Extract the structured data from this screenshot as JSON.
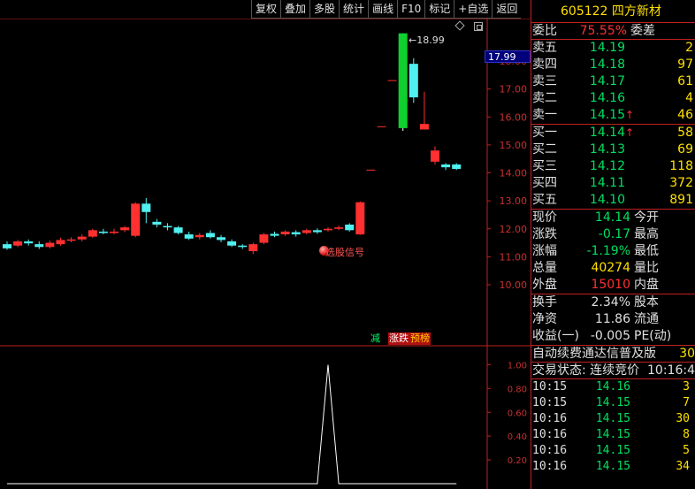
{
  "toolbar": [
    "复权",
    "叠加",
    "多股",
    "统计",
    "画线",
    "F10",
    "标记",
    "+自选",
    "返回"
  ],
  "stock": {
    "code": "605122",
    "name": "四方新材"
  },
  "weibi": {
    "label": "委比",
    "value": "75.55%",
    "label2": "委差"
  },
  "sell": [
    {
      "label": "卖五",
      "price": "14.19",
      "vol": "2",
      "arrow": ""
    },
    {
      "label": "卖四",
      "price": "14.18",
      "vol": "97",
      "arrow": ""
    },
    {
      "label": "卖三",
      "price": "14.17",
      "vol": "61",
      "arrow": ""
    },
    {
      "label": "卖二",
      "price": "14.16",
      "vol": "4",
      "arrow": ""
    },
    {
      "label": "卖一",
      "price": "14.15",
      "vol": "46",
      "arrow": "↑"
    }
  ],
  "buy": [
    {
      "label": "买一",
      "price": "14.14",
      "vol": "58",
      "arrow": "↑"
    },
    {
      "label": "买二",
      "price": "14.13",
      "vol": "69",
      "arrow": ""
    },
    {
      "label": "买三",
      "price": "14.12",
      "vol": "118",
      "arrow": ""
    },
    {
      "label": "买四",
      "price": "14.11",
      "vol": "372",
      "arrow": ""
    },
    {
      "label": "买五",
      "price": "14.10",
      "vol": "891",
      "arrow": ""
    }
  ],
  "quote": [
    {
      "label": "现价",
      "value": "14.14",
      "label2": "今开",
      "color": "green"
    },
    {
      "label": "涨跌",
      "value": "-0.17",
      "label2": "最高",
      "color": "green"
    },
    {
      "label": "涨幅",
      "value": "-1.19%",
      "label2": "最低",
      "color": "green"
    },
    {
      "label": "总量",
      "value": "40274",
      "label2": "量比",
      "color": "yellow"
    },
    {
      "label": "外盘",
      "value": "15010",
      "label2": "内盘",
      "color": "red"
    }
  ],
  "fundamentals": [
    {
      "label": "换手",
      "value": "2.34%",
      "label2": "股本"
    },
    {
      "label": "净资",
      "value": "11.86",
      "label2": "流通"
    },
    {
      "label": "收益(一)",
      "value": "-0.005",
      "label2": "PE(动)"
    }
  ],
  "ticker": {
    "text": "自动续费通达信普及版",
    "num": "30"
  },
  "trade_status": {
    "text": "交易状态: 连续竞价",
    "time": "10:16:4"
  },
  "trades": [
    {
      "time": "10:15",
      "price": "14.16",
      "vol": "3"
    },
    {
      "time": "10:15",
      "price": "14.15",
      "vol": "7"
    },
    {
      "time": "10:16",
      "price": "14.15",
      "vol": "30"
    },
    {
      "time": "10:16",
      "price": "14.15",
      "vol": "8"
    },
    {
      "time": "10:16",
      "price": "14.15",
      "vol": "5"
    },
    {
      "time": "10:16",
      "price": "14.15",
      "vol": "34"
    }
  ],
  "chart_data": {
    "type": "candlestick",
    "price_axis": {
      "ticks": [
        "18.00",
        "17.00",
        "16.00",
        "15.00",
        "14.00",
        "13.00",
        "12.00",
        "11.00",
        "10.00"
      ],
      "min": 9.6,
      "max": 18.6
    },
    "current_price_tag": "17.99",
    "high_label": "18.99",
    "signal_label": "选股信号",
    "indicator_axis": {
      "ticks": [
        "1.00",
        "0.80",
        "0.60",
        "0.40",
        "0.20"
      ],
      "min": 0,
      "max": 1.1
    },
    "tags": {
      "jian": "减",
      "zhangdie": "涨跌",
      "yubang": "预榜"
    },
    "candles": [
      {
        "o": 11.45,
        "c": 11.3,
        "h": 11.55,
        "l": 11.25
      },
      {
        "o": 11.4,
        "c": 11.55,
        "h": 11.6,
        "l": 11.35
      },
      {
        "o": 11.55,
        "c": 11.48,
        "h": 11.62,
        "l": 11.4
      },
      {
        "o": 11.45,
        "c": 11.35,
        "h": 11.55,
        "l": 11.28
      },
      {
        "o": 11.35,
        "c": 11.5,
        "h": 11.58,
        "l": 11.3
      },
      {
        "o": 11.45,
        "c": 11.6,
        "h": 11.68,
        "l": 11.4
      },
      {
        "o": 11.58,
        "c": 11.62,
        "h": 11.7,
        "l": 11.52
      },
      {
        "o": 11.62,
        "c": 11.72,
        "h": 11.8,
        "l": 11.55
      },
      {
        "o": 11.72,
        "c": 11.95,
        "h": 12.0,
        "l": 11.68
      },
      {
        "o": 11.9,
        "c": 11.85,
        "h": 12.0,
        "l": 11.8
      },
      {
        "o": 11.85,
        "c": 11.9,
        "h": 12.0,
        "l": 11.8
      },
      {
        "o": 11.95,
        "c": 12.05,
        "h": 12.1,
        "l": 11.88
      },
      {
        "o": 11.75,
        "c": 12.9,
        "h": 12.95,
        "l": 11.7
      },
      {
        "o": 12.9,
        "c": 12.6,
        "h": 13.1,
        "l": 12.2
      },
      {
        "o": 12.25,
        "c": 12.15,
        "h": 12.35,
        "l": 12.05
      },
      {
        "o": 12.1,
        "c": 12.05,
        "h": 12.2,
        "l": 11.95
      },
      {
        "o": 12.05,
        "c": 11.85,
        "h": 12.1,
        "l": 11.8
      },
      {
        "o": 11.8,
        "c": 11.65,
        "h": 11.9,
        "l": 11.6
      },
      {
        "o": 11.7,
        "c": 11.78,
        "h": 11.85,
        "l": 11.62
      },
      {
        "o": 11.85,
        "c": 11.7,
        "h": 11.95,
        "l": 11.65
      },
      {
        "o": 11.7,
        "c": 11.6,
        "h": 11.78,
        "l": 11.52
      },
      {
        "o": 11.55,
        "c": 11.4,
        "h": 11.62,
        "l": 11.35
      },
      {
        "o": 11.4,
        "c": 11.35,
        "h": 11.45,
        "l": 11.28
      },
      {
        "o": 11.2,
        "c": 11.45,
        "h": 11.5,
        "l": 11.1
      },
      {
        "o": 11.5,
        "c": 11.8,
        "h": 11.85,
        "l": 11.45
      },
      {
        "o": 11.82,
        "c": 11.75,
        "h": 11.9,
        "l": 11.7
      },
      {
        "o": 11.8,
        "c": 11.9,
        "h": 11.95,
        "l": 11.75
      },
      {
        "o": 11.88,
        "c": 11.8,
        "h": 11.95,
        "l": 11.72
      },
      {
        "o": 11.85,
        "c": 11.95,
        "h": 12.0,
        "l": 11.8
      },
      {
        "o": 11.95,
        "c": 11.88,
        "h": 12.02,
        "l": 11.82
      },
      {
        "o": 11.95,
        "c": 12.0,
        "h": 12.05,
        "l": 11.9
      },
      {
        "o": 12.0,
        "c": 12.05,
        "h": 12.12,
        "l": 11.95
      },
      {
        "o": 12.15,
        "c": 11.95,
        "h": 12.2,
        "l": 11.9
      },
      {
        "o": 11.8,
        "c": 12.95,
        "h": 12.98,
        "l": 11.78
      },
      {
        "o": 14.1,
        "c": 14.1,
        "h": 14.1,
        "l": 14.1
      },
      {
        "o": 15.65,
        "c": 15.65,
        "h": 15.65,
        "l": 15.65
      },
      {
        "o": 17.3,
        "c": 17.3,
        "h": 17.3,
        "l": 17.3
      },
      {
        "o": 15.6,
        "c": 18.99,
        "h": 18.99,
        "l": 15.5
      },
      {
        "o": 17.9,
        "c": 16.7,
        "h": 18.1,
        "l": 16.5
      },
      {
        "o": 15.55,
        "c": 15.75,
        "h": 16.9,
        "l": 15.55
      },
      {
        "o": 14.4,
        "c": 14.8,
        "h": 14.95,
        "l": 14.3
      },
      {
        "o": 14.3,
        "c": 14.2,
        "h": 14.35,
        "l": 14.1
      },
      {
        "o": 14.3,
        "c": 14.14,
        "h": 14.35,
        "l": 14.1
      }
    ],
    "indicator": [
      0,
      0,
      0,
      0,
      0,
      0,
      0,
      0,
      0,
      0,
      0,
      0,
      0,
      0,
      0,
      0,
      0,
      0,
      0,
      0,
      0,
      0,
      0,
      0,
      0,
      0,
      0,
      0,
      0,
      0,
      1,
      0,
      0,
      0,
      0,
      0,
      0,
      0,
      0,
      0,
      0,
      0,
      0
    ]
  }
}
